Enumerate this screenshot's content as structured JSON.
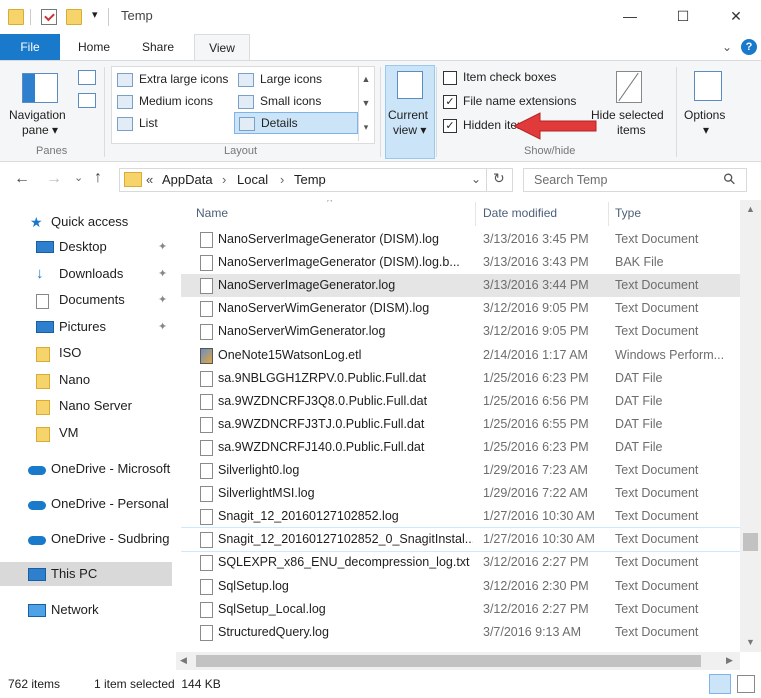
{
  "window": {
    "title": "Temp",
    "min_glyph": "—",
    "max_glyph": "☐",
    "close_glyph": "✕"
  },
  "tabs": {
    "file": "File",
    "home": "Home",
    "share": "Share",
    "view": "View",
    "help_glyph": "?",
    "collapse_glyph": "⌄"
  },
  "ribbon": {
    "panes": {
      "navigation_pane": "Navigation",
      "navigation_pane2": "pane ▾",
      "group": "Panes"
    },
    "layout": {
      "extra_large": "Extra large icons",
      "large": "Large icons",
      "medium": "Medium icons",
      "small": "Small icons",
      "list": "List",
      "details": "Details",
      "group": "Layout"
    },
    "current_view": {
      "line1": "Current",
      "line2": "view ▾"
    },
    "show_hide": {
      "item_check_boxes": "Item check boxes",
      "file_name_extensions": "File name extensions",
      "hidden_items": "Hidden items",
      "hide_selected": "Hide selected",
      "hide_selected2": "items",
      "group": "Show/hide",
      "item_check_boxes_checked": false,
      "file_name_extensions_checked": true,
      "hidden_items_checked": true
    },
    "options": {
      "label": "Options",
      "label2": "▾"
    },
    "accent_color": "#1979ca",
    "arrow_color": "#e03a3a"
  },
  "address": {
    "back": "←",
    "forward": "→",
    "dropdown": "⌄",
    "up": "↑",
    "chevron": "«",
    "crumbs": [
      "AppData",
      "Local",
      "Temp"
    ],
    "crumb_sep": "›",
    "refresh": "↻",
    "search_placeholder": "Search Temp",
    "search_icon": "⚲"
  },
  "nav": {
    "quick_access": "Quick access",
    "items": [
      {
        "label": "Desktop",
        "pinned": true
      },
      {
        "label": "Downloads",
        "pinned": true
      },
      {
        "label": "Documents",
        "pinned": true
      },
      {
        "label": "Pictures",
        "pinned": true
      },
      {
        "label": "ISO",
        "pinned": false
      },
      {
        "label": "Nano",
        "pinned": false
      },
      {
        "label": "Nano Server",
        "pinned": false
      },
      {
        "label": "VM",
        "pinned": false
      }
    ],
    "pin_glyph": "📌",
    "onedrive_microsoft": "OneDrive - Microsoft",
    "onedrive_personal": "OneDrive - Personal",
    "onedrive_sudbring": "OneDrive - Sudbring",
    "this_pc": "This PC",
    "network": "Network"
  },
  "columns": {
    "name": "Name",
    "date": "Date modified",
    "type": "Type",
    "sort_glyph": "^"
  },
  "files": [
    {
      "name": "NanoServerImageGenerator (DISM).log",
      "date": "3/13/2016 3:45 PM",
      "type": "Text Document"
    },
    {
      "name": "NanoServerImageGenerator (DISM).log.b...",
      "date": "3/13/2016 3:43 PM",
      "type": "BAK File"
    },
    {
      "name": "NanoServerImageGenerator.log",
      "date": "3/13/2016 3:44 PM",
      "type": "Text Document"
    },
    {
      "name": "NanoServerWimGenerator (DISM).log",
      "date": "3/12/2016 9:05 PM",
      "type": "Text Document"
    },
    {
      "name": "NanoServerWimGenerator.log",
      "date": "3/12/2016 9:05 PM",
      "type": "Text Document"
    },
    {
      "name": "OneNote15WatsonLog.etl",
      "date": "2/14/2016 1:17 AM",
      "type": "Windows Perform..."
    },
    {
      "name": "sa.9NBLGGH1ZRPV.0.Public.Full.dat",
      "date": "1/25/2016 6:23 PM",
      "type": "DAT File"
    },
    {
      "name": "sa.9WZDNCRFJ3Q8.0.Public.Full.dat",
      "date": "1/25/2016 6:56 PM",
      "type": "DAT File"
    },
    {
      "name": "sa.9WZDNCRFJ3TJ.0.Public.Full.dat",
      "date": "1/25/2016 6:55 PM",
      "type": "DAT File"
    },
    {
      "name": "sa.9WZDNCRFJ140.0.Public.Full.dat",
      "date": "1/25/2016 6:23 PM",
      "type": "DAT File"
    },
    {
      "name": "Silverlight0.log",
      "date": "1/29/2016 7:23 AM",
      "type": "Text Document"
    },
    {
      "name": "SilverlightMSI.log",
      "date": "1/29/2016 7:22 AM",
      "type": "Text Document"
    },
    {
      "name": "Snagit_12_20160127102852.log",
      "date": "1/27/2016 10:30 AM",
      "type": "Text Document"
    },
    {
      "name": "Snagit_12_20160127102852_0_SnagitInstal...",
      "date": "1/27/2016 10:30 AM",
      "type": "Text Document"
    },
    {
      "name": "SQLEXPR_x86_ENU_decompression_log.txt",
      "date": "3/12/2016 2:27 PM",
      "type": "Text Document"
    },
    {
      "name": "SqlSetup.log",
      "date": "3/12/2016 2:30 PM",
      "type": "Text Document"
    },
    {
      "name": "SqlSetup_Local.log",
      "date": "3/12/2016 2:27 PM",
      "type": "Text Document"
    },
    {
      "name": "StructuredQuery.log",
      "date": "3/7/2016 9:13 AM",
      "type": "Text Document"
    }
  ],
  "selected_index": 2,
  "hover_index": 13,
  "status": {
    "count": "762 items",
    "selection": "1 item selected  144 KB"
  }
}
